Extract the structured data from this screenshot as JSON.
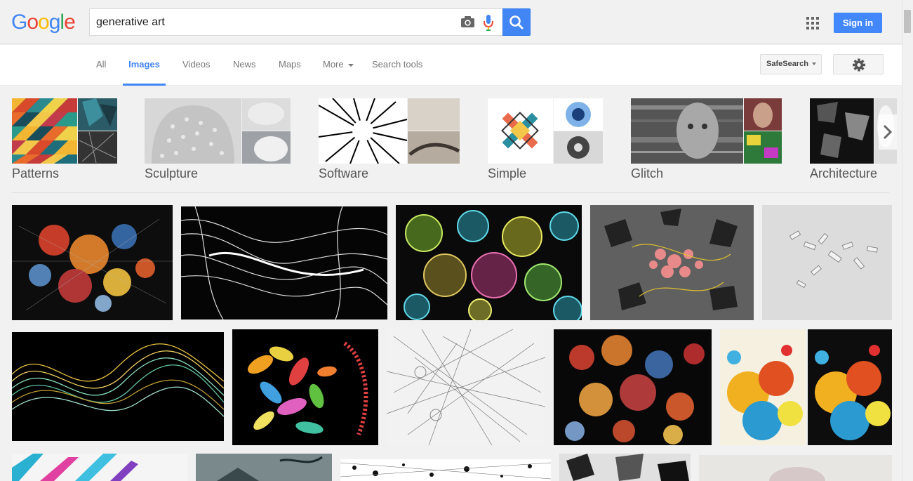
{
  "logo": {
    "letters": [
      "G",
      "o",
      "o",
      "g",
      "l",
      "e"
    ],
    "colors": [
      "#4285f4",
      "#ea4335",
      "#fbbc05",
      "#4285f4",
      "#34a853",
      "#ea4335"
    ]
  },
  "search": {
    "query": "generative art",
    "camera_icon": "camera-icon",
    "mic_icon": "microphone-icon",
    "button_icon": "search-icon"
  },
  "header": {
    "apps_icon": "apps-grid-icon",
    "signin_label": "Sign in"
  },
  "nav": {
    "tabs": [
      {
        "label": "All",
        "active": false
      },
      {
        "label": "Images",
        "active": true
      },
      {
        "label": "Videos",
        "active": false
      },
      {
        "label": "News",
        "active": false
      },
      {
        "label": "Maps",
        "active": false
      },
      {
        "label": "More",
        "active": false
      },
      {
        "label": "Search tools",
        "active": false
      }
    ],
    "safesearch_label": "SafeSearch",
    "settings_icon": "gear-icon"
  },
  "related": [
    {
      "label": "Patterns"
    },
    {
      "label": "Sculpture"
    },
    {
      "label": "Software"
    },
    {
      "label": "Simple"
    },
    {
      "label": "Glitch"
    },
    {
      "label": "Architecture"
    }
  ],
  "results": {
    "count": 15
  },
  "colors": {
    "accent": "#4285f4",
    "signin": "#4387fd",
    "background": "#f1f1f1"
  }
}
